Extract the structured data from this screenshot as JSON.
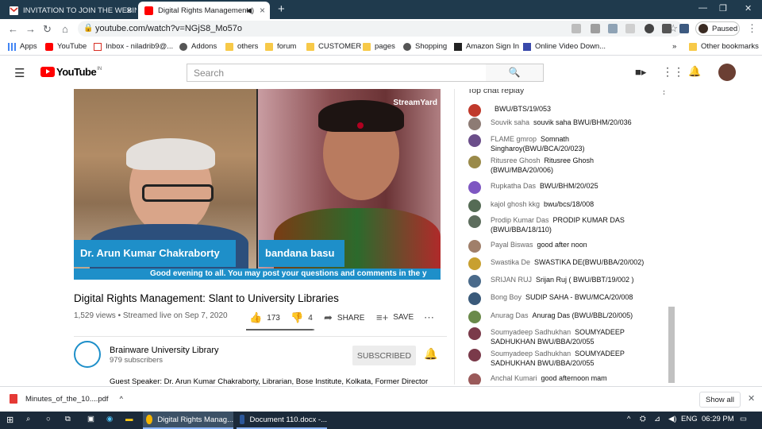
{
  "browser": {
    "tabs": [
      {
        "label": "INVITATION TO JOIN THE WEBIN"
      },
      {
        "label": "Digital Rights Management:"
      }
    ],
    "url": "youtube.com/watch?v=NGjS8_Mo57o",
    "profile_status": "Paused",
    "bookmarks": [
      "Apps",
      "YouTube",
      "Inbox - niladrib9@...",
      "Addons",
      "others",
      "forum",
      "CUSTOMER",
      "pages",
      "Shopping",
      "Amazon Sign In",
      "Online Video Down...",
      "Other bookmarks"
    ]
  },
  "youtube": {
    "logo_text": "YouTube",
    "logo_country": "IN",
    "search_placeholder": "Search"
  },
  "video": {
    "speaker1": "Dr. Arun Kumar Chakraborty",
    "speaker2": "bandana basu",
    "ticker": "Good evening to all. You may post your questions and comments in the y",
    "watermark": "StreamYard",
    "title": "Digital Rights Management: Slant to University Libraries",
    "meta": "1,529 views • Streamed live on Sep 7, 2020",
    "likes": "173",
    "dislikes": "4",
    "share_label": "SHARE",
    "save_label": "SAVE",
    "like_ratio": 0.977
  },
  "channel": {
    "name": "Brainware University Library",
    "subscribers": "979 subscribers",
    "subscribed_label": "SUBSCRIBED",
    "description": "Guest Speaker: Dr. Arun Kumar Chakraborty, Librarian, Bose Institute, Kolkata, Former Director"
  },
  "chat": {
    "header": "Top chat replay",
    "messages": [
      {
        "author": "",
        "text": "BWU/BTS/19/053",
        "color": "#c0392b"
      },
      {
        "author": "Souvik saha",
        "text": "souvik saha BWU/BHM/20/036",
        "color": "#8d7b74"
      },
      {
        "author": "FLAME gmrop",
        "text": "Somnath Singharoy(BWU/BCA/20/023)",
        "color": "#6b4e8a"
      },
      {
        "author": "Ritusree Ghosh",
        "text": "Ritusree Ghosh (BWU/MBA/20/006)",
        "color": "#9a8a4a"
      },
      {
        "author": "Rupkatha Das",
        "text": "BWU/BHM/20/025",
        "color": "#7e57c2"
      },
      {
        "author": "kajol ghosh kkg",
        "text": "bwu/bcs/18/008",
        "color": "#556b55"
      },
      {
        "author": "Prodip Kumar Das",
        "text": "PRODIP KUMAR DAS (BWU/BBA/18/110)",
        "color": "#5d6d5d"
      },
      {
        "author": "Payal Biswas",
        "text": "good after noon",
        "color": "#a07f6a"
      },
      {
        "author": "Swastika De",
        "text": "SWASTIKA DE(BWU/BBA/20/002)",
        "color": "#c8a030"
      },
      {
        "author": "SRIJAN RUJ",
        "text": "Srijan Ruj ( BWU/BBT/19/002 )",
        "color": "#4a6a8a"
      },
      {
        "author": "Bong Boy",
        "text": "SUDIP SAHA - BWU/MCA/20/008",
        "color": "#3a5a7a"
      },
      {
        "author": "Anurag Das",
        "text": "Anurag Das (BWU/BBL/20/005)",
        "color": "#6a8a4a"
      },
      {
        "author": "Soumyadeep Sadhukhan",
        "text": "SOUMYADEEP SADHUKHAN BWU/BBA/20/055",
        "color": "#7a3a4a"
      },
      {
        "author": "Soumyadeep Sadhukhan",
        "text": "SOUMYADEEP SADHUKHAN BWU/BBA/20/055",
        "color": "#7a3a4a"
      },
      {
        "author": "Anchal Kumari",
        "text": "good afternoon mam",
        "color": "#9a5a5a"
      }
    ]
  },
  "download": {
    "file": "Minutes_of_the_10....pdf",
    "show_all": "Show all"
  },
  "taskbar": {
    "apps": [
      "Digital Rights Manag...",
      "Document 110.docx -..."
    ],
    "language": "ENG",
    "time": "06:29 PM"
  }
}
